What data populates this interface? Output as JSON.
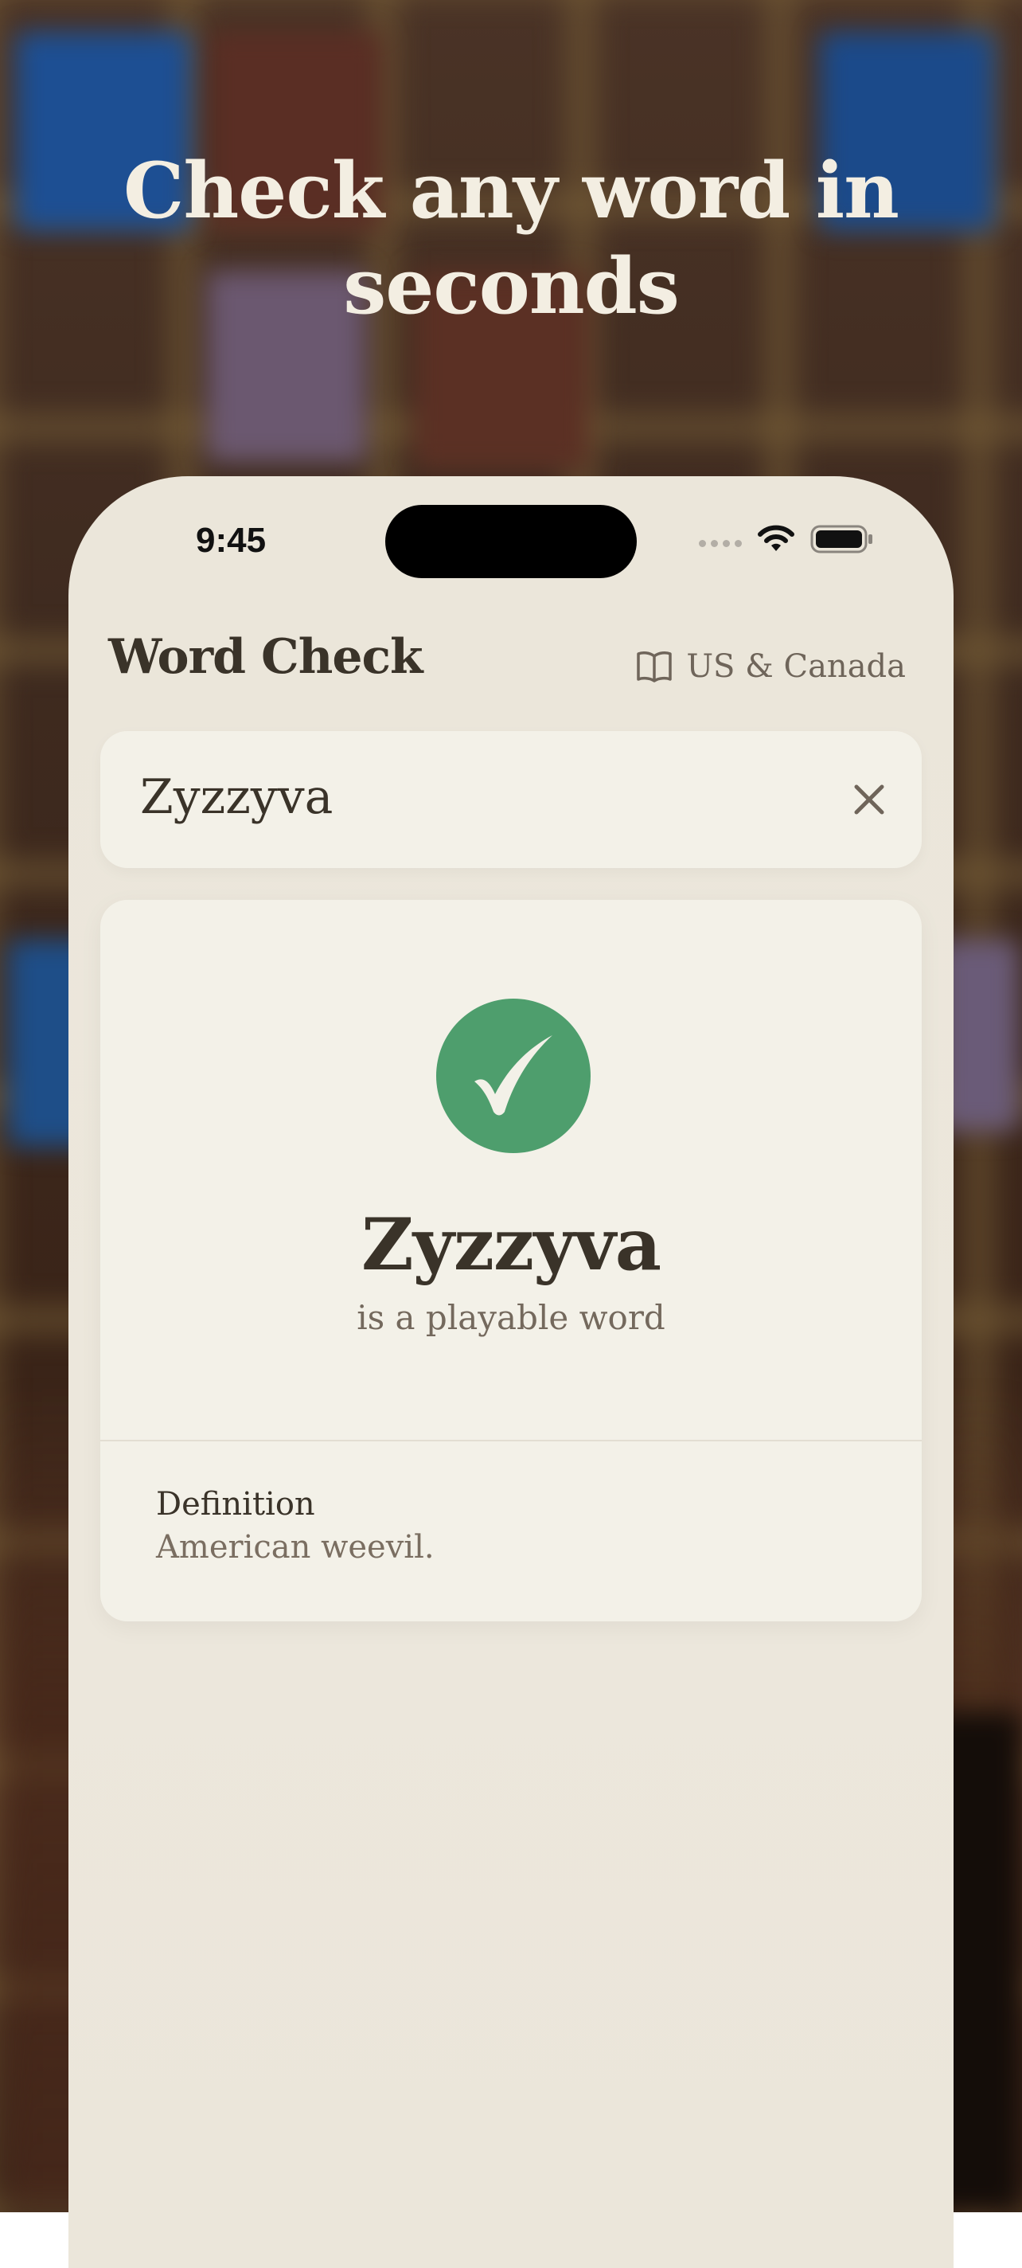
{
  "headline": "Check any word in seconds",
  "status_bar": {
    "time": "9:45"
  },
  "app": {
    "title": "Word Check",
    "region_label": "US & Canada",
    "region_icon": "book-open-icon"
  },
  "search": {
    "value": "Zyzzyva",
    "clear_icon": "close-icon"
  },
  "result": {
    "status_icon": "checkmark-icon",
    "status_color": "#4e9e6d",
    "word": "Zyzzyva",
    "verdict": "is a playable word",
    "definition_label": "Definition",
    "definition_text": "American weevil."
  }
}
